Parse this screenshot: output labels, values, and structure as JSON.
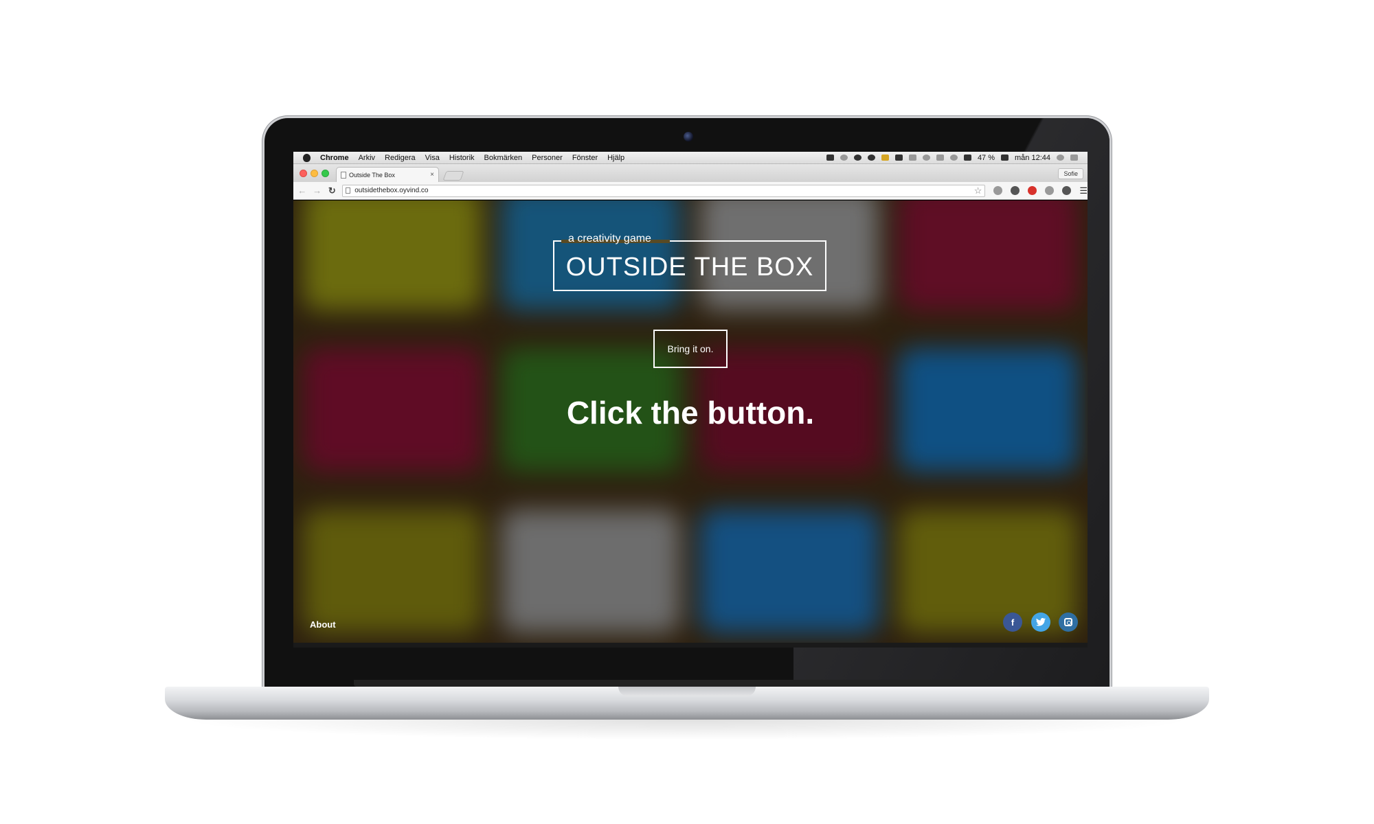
{
  "menubar": {
    "app_name": "Chrome",
    "menus": [
      "Arkiv",
      "Redigera",
      "Visa",
      "Historik",
      "Bokmärken",
      "Personer",
      "Fönster",
      "Hjälp"
    ],
    "battery": "47 %",
    "clock": "mån 12:44"
  },
  "browser": {
    "tab_title": "Outside The Box",
    "tab_close": "×",
    "profile": "Sofie",
    "url": "outsidethebox.oyvind.co"
  },
  "page": {
    "tagline": "a creativity game",
    "title": "OUTSIDE THE BOX",
    "button_label": "Bring it on.",
    "headline": "Click the button.",
    "about_label": "About",
    "social": [
      "facebook",
      "twitter",
      "instagram"
    ]
  },
  "colors": {
    "tiles": [
      "#8a8a12",
      "#1c6c9c",
      "#8f8f8f",
      "#7a1230",
      "#7a1030",
      "#2e6a1e",
      "#6e0f2a",
      "#1467a8",
      "#7a7510",
      "#8c8c8c",
      "#1a67a6",
      "#7d7810"
    ],
    "facebook": "#3a5796",
    "twitter": "#43a5e6",
    "instagram": "#2f6fa3"
  }
}
